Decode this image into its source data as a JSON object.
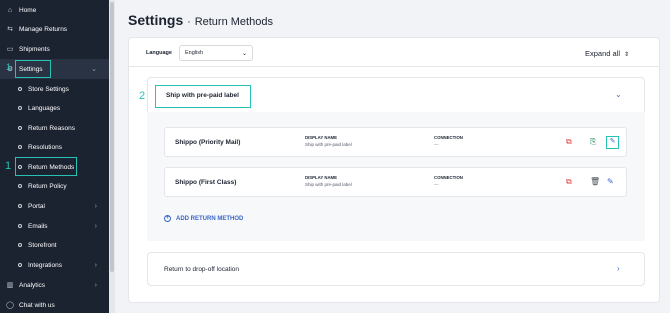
{
  "sidebar": {
    "items": [
      {
        "label": "Home",
        "icon": "home-icon",
        "glyph": "⌂"
      },
      {
        "label": "Manage Returns",
        "icon": "return-icon",
        "glyph": "⇆"
      },
      {
        "label": "Shipments",
        "icon": "truck-icon",
        "glyph": "▭"
      },
      {
        "label": "Settings",
        "icon": "gear-icon",
        "glyph": "⚙",
        "chevron": "⌄"
      },
      {
        "label": "Store Settings"
      },
      {
        "label": "Languages"
      },
      {
        "label": "Return Reasons"
      },
      {
        "label": "Resolutions"
      },
      {
        "label": "Return Methods"
      },
      {
        "label": "Return Policy"
      },
      {
        "label": "Portal",
        "chevron": "›"
      },
      {
        "label": "Emails",
        "chevron": "›"
      },
      {
        "label": "Storefront"
      },
      {
        "label": "Integrations",
        "chevron": "›"
      },
      {
        "label": "Analytics",
        "icon": "chart-icon",
        "glyph": "▥",
        "chevron": "›"
      },
      {
        "label": "Chat with us",
        "icon": "chat-icon",
        "glyph": "◯"
      }
    ]
  },
  "annotations": {
    "n1": "1",
    "n1b": "1",
    "n2": "2"
  },
  "header": {
    "title": "Settings",
    "separator": "·",
    "subtitle": "Return Methods"
  },
  "language": {
    "label": "Language",
    "value": "English"
  },
  "expand_all": "Expand all",
  "panel": {
    "label": "Ship with pre-paid label",
    "methods": [
      {
        "name": "Shippo (Priority Mail)",
        "dn_header": "DISPLAY NAME",
        "dn_value": "Ship with pre-paid label",
        "cn_header": "CONNECTION",
        "cn_value": "---"
      },
      {
        "name": "Shippo (First Class)",
        "dn_header": "DISPLAY NAME",
        "dn_value": "Ship with pre-paid label",
        "cn_header": "CONNECTION",
        "cn_value": "---"
      }
    ],
    "add_label": "ADD RETURN METHOD"
  },
  "panel2": {
    "label": "Return to drop-off location"
  },
  "colors": {
    "accent": "#27c1b6",
    "sidebar_bg": "#1b2230",
    "link": "#3b67c8",
    "danger": "#e0413f"
  }
}
